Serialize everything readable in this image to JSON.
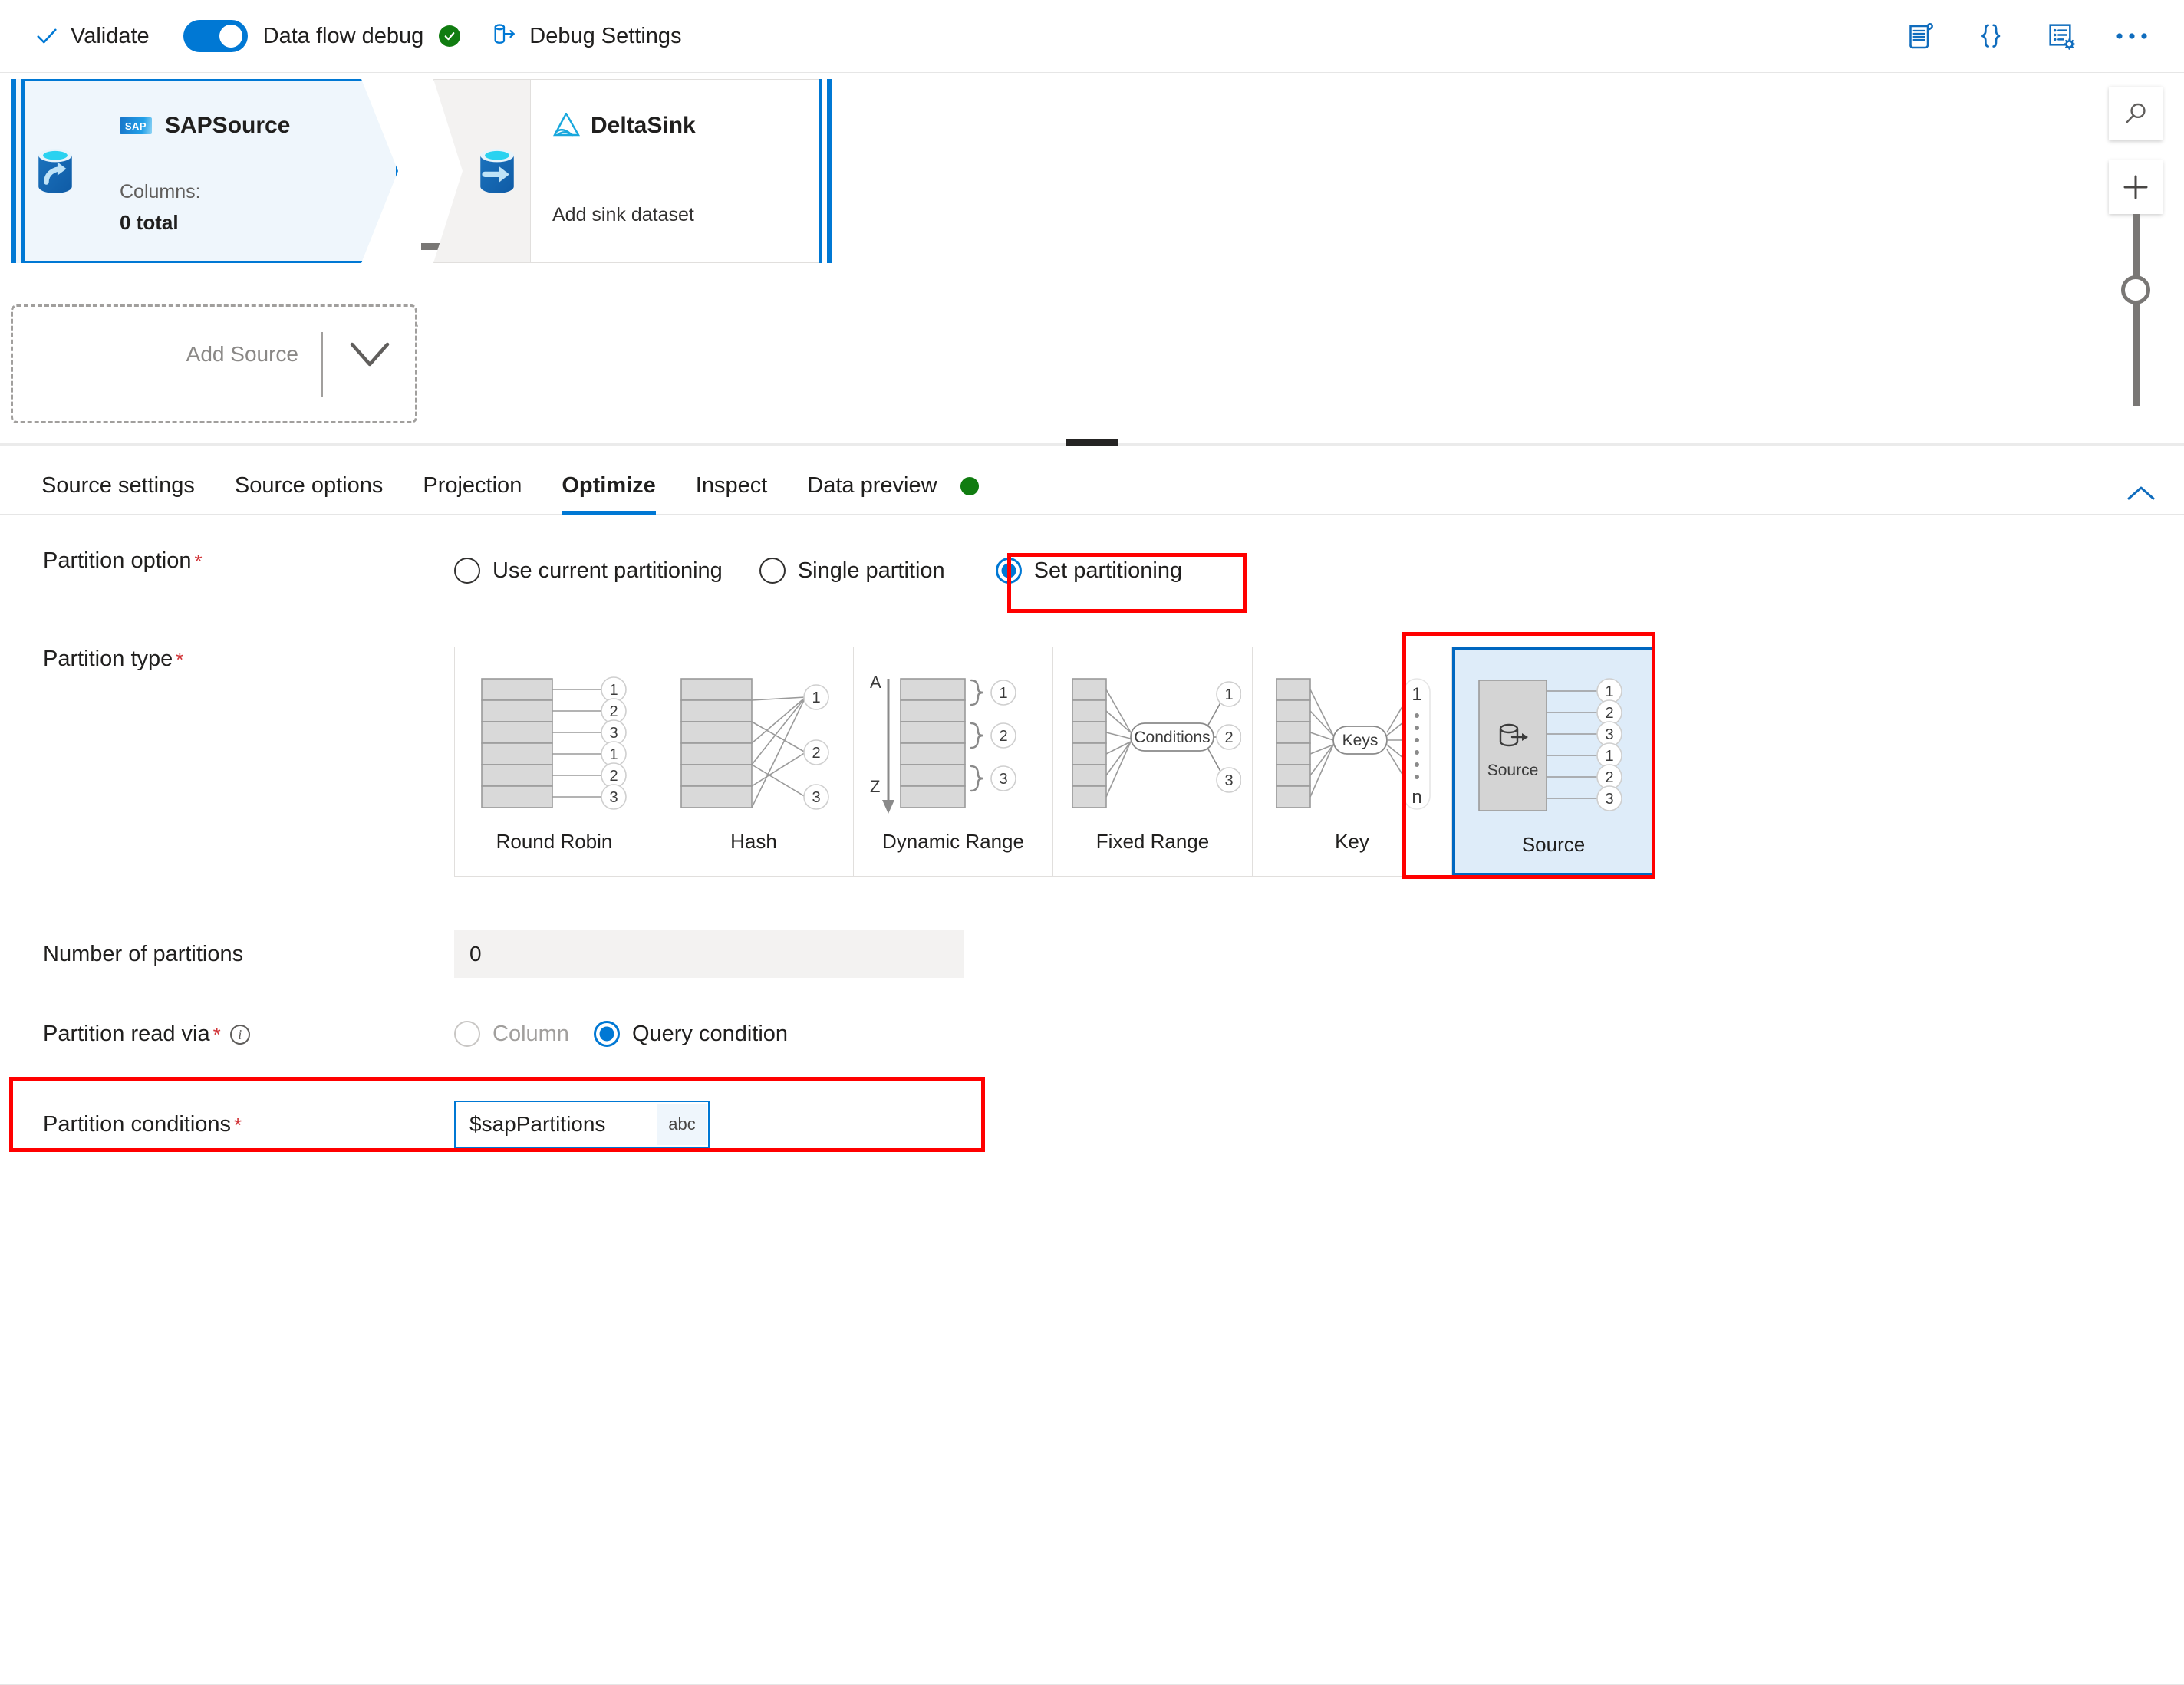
{
  "toolbar": {
    "validate_label": "Validate",
    "data_flow_debug_label": "Data flow debug",
    "debug_settings_label": "Debug Settings",
    "toggle_state": "on",
    "debug_status": "active",
    "icons": {
      "check": "check-icon",
      "debug_settings": "debug-settings-icon",
      "script": "script-icon",
      "code": "code-braces-icon",
      "properties": "properties-icon",
      "more": "more-ellipsis-icon"
    },
    "accent_color": "#0078d4",
    "success_color": "#107c10"
  },
  "canvas": {
    "source_node": {
      "title": "SAPSource",
      "logo_text": "SAP",
      "sub_label": "Columns:",
      "sub_value": "0 total",
      "selected": true
    },
    "sink_node": {
      "title": "DeltaSink",
      "sub_label": "Add sink dataset",
      "selected": true
    },
    "add_source": {
      "label": "Add Source"
    },
    "tools": {
      "search_label": "search-icon",
      "add_label": "plus-icon",
      "zoom_slider": "zoom-slider"
    }
  },
  "tabs": {
    "items": [
      {
        "label": "Source settings",
        "active": false
      },
      {
        "label": "Source options",
        "active": false
      },
      {
        "label": "Projection",
        "active": false
      },
      {
        "label": "Optimize",
        "active": true
      },
      {
        "label": "Inspect",
        "active": false
      },
      {
        "label": "Data preview",
        "active": false,
        "status": "green"
      }
    ],
    "collapse_icon": "chevron-up-icon"
  },
  "form": {
    "partition_option": {
      "label": "Partition option",
      "required": true,
      "options": [
        {
          "label": "Use current partitioning",
          "checked": false
        },
        {
          "label": "Single partition",
          "checked": false
        },
        {
          "label": "Set partitioning",
          "checked": true,
          "highlighted": true
        }
      ]
    },
    "partition_type": {
      "label": "Partition type",
      "required": true,
      "cards": [
        {
          "label": "Round Robin",
          "selected": false
        },
        {
          "label": "Hash",
          "selected": false
        },
        {
          "label": "Dynamic Range",
          "selected": false,
          "axis_start": "A",
          "axis_end": "Z"
        },
        {
          "label": "Fixed Range",
          "selected": false,
          "node_label": "Conditions"
        },
        {
          "label": "Key",
          "selected": false,
          "node_label": "Keys",
          "range_start": "1",
          "range_end": "n"
        },
        {
          "label": "Source",
          "selected": true,
          "node_label": "Source",
          "highlighted": true
        }
      ],
      "bucket_labels": [
        "1",
        "2",
        "3",
        "1",
        "2",
        "3"
      ],
      "bucket_labels_short": [
        "1",
        "2",
        "3"
      ]
    },
    "number_of_partitions": {
      "label": "Number of partitions",
      "value": "0",
      "required": false
    },
    "partition_read_via": {
      "label": "Partition read via",
      "required": true,
      "has_info": true,
      "options": [
        {
          "label": "Column",
          "checked": false,
          "disabled": true
        },
        {
          "label": "Query condition",
          "checked": true,
          "disabled": false
        }
      ]
    },
    "partition_conditions": {
      "label": "Partition conditions",
      "required": true,
      "value": "$sapPartitions",
      "badge": "abc",
      "highlighted": true
    }
  },
  "annotation_color": "#ff0000"
}
